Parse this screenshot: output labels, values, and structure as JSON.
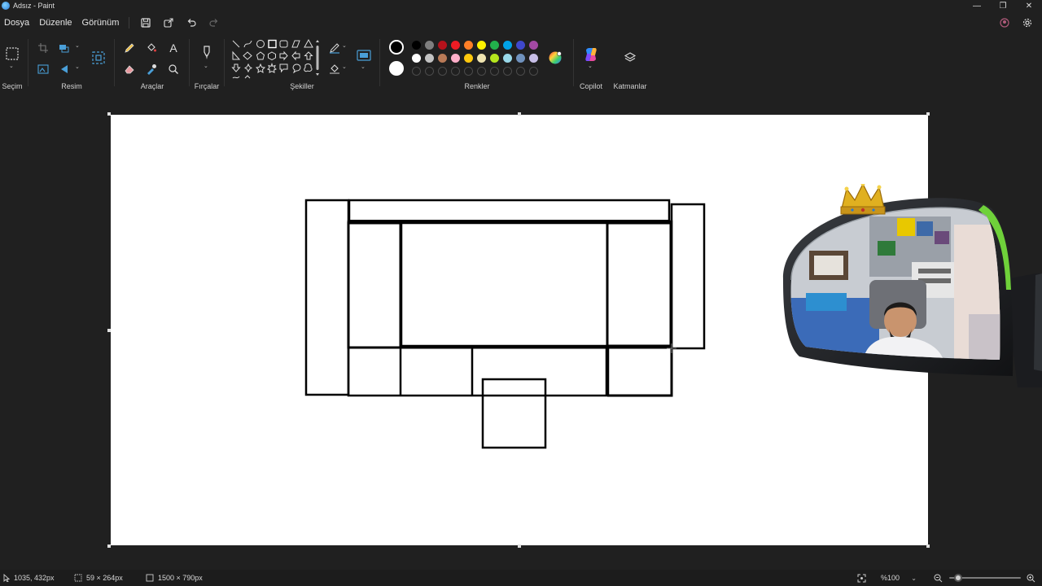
{
  "window": {
    "title": "Adsız - Paint",
    "minimize": "—",
    "maximize": "❐",
    "close": "✕"
  },
  "menu": {
    "file": "Dosya",
    "edit": "Düzenle",
    "view": "Görünüm"
  },
  "ribbon": {
    "selection": "Seçim",
    "image": "Resim",
    "tools": "Araçlar",
    "brushes": "Fırçalar",
    "shapes": "Şekiller",
    "colors": "Renkler",
    "copilot": "Copilot",
    "layers": "Katmanlar",
    "text_tool": "A"
  },
  "palette": {
    "primary": "#000000",
    "secondary": "#ffffff",
    "row1": [
      "#000000",
      "#7f7f7f",
      "#b5121b",
      "#ee1c24",
      "#ff7f27",
      "#fff200",
      "#22b14c",
      "#00a2e8",
      "#3f48cc",
      "#a349a4"
    ],
    "row2": [
      "#ffffff",
      "#c3c3c3",
      "#b97a57",
      "#ffaec9",
      "#ffc90e",
      "#efe4b0",
      "#b5e61d",
      "#99d9ea",
      "#7092be",
      "#c8bfe7"
    ],
    "row3_empty_count": 10
  },
  "status": {
    "cursor": "1035, 432px",
    "selection_size": "59 × 264px",
    "canvas_size": "1500 × 790px",
    "zoom": "%100",
    "zoom_level": 0.12
  },
  "colors": {
    "accent": "#0078d4",
    "background": "#202020",
    "canvas": "#ffffff"
  }
}
